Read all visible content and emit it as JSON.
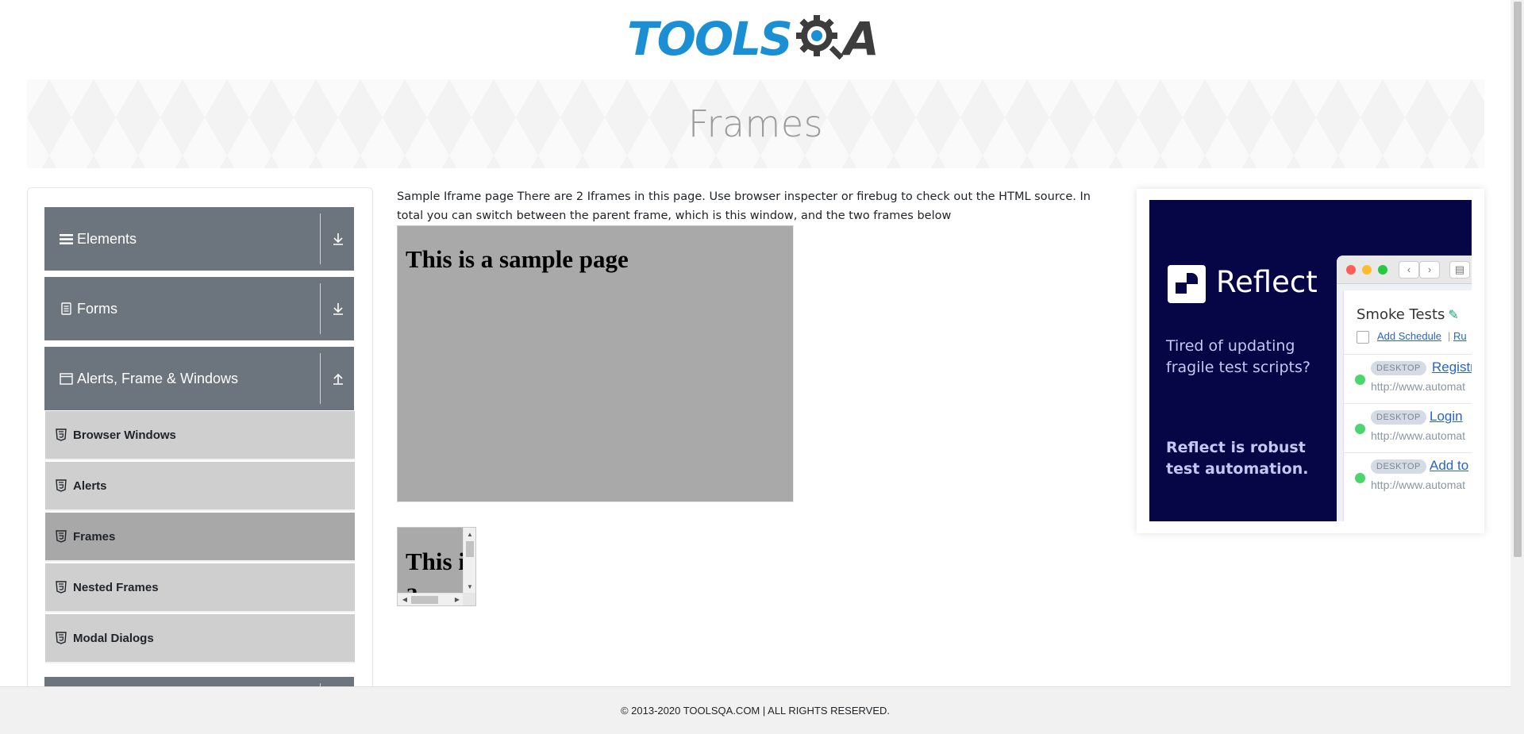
{
  "header": {
    "logo_text": "TOOLS",
    "logo_suffix": "A"
  },
  "banner": {
    "title": "Frames"
  },
  "sidebar": {
    "groups": [
      {
        "label": "Elements"
      },
      {
        "label": "Forms"
      },
      {
        "label": "Alerts, Frame & Windows"
      }
    ],
    "items": [
      {
        "label": "Browser Windows"
      },
      {
        "label": "Alerts"
      },
      {
        "label": "Frames"
      },
      {
        "label": "Nested Frames"
      },
      {
        "label": "Modal Dialogs"
      }
    ]
  },
  "main": {
    "description": "Sample Iframe page There are 2 Iframes in this page. Use browser inspecter or firebug to check out the HTML source. In total you can switch between the parent frame, which is this window, and the two frames below",
    "frame1_heading": "This is a sample page",
    "frame2_heading": "This is a"
  },
  "ad": {
    "brand": "Reflect",
    "tagline1": "Tired of updating fragile test scripts?",
    "tagline2": "Reflect is robust test automation.",
    "window": {
      "title": "Smoke Tests",
      "add_schedule": "Add Schedule",
      "run": "Ru",
      "rows": [
        {
          "chip": "DESKTOP",
          "name": "Registr",
          "url": "http://www.automat"
        },
        {
          "chip": "DESKTOP",
          "name": "Login",
          "url": "http://www.automat"
        },
        {
          "chip": "DESKTOP",
          "name": "Add to",
          "url": "http://www.automat"
        }
      ]
    }
  },
  "footer": {
    "text": "© 2013-2020 TOOLSQA.COM | ALL RIGHTS RESERVED."
  },
  "colors": {
    "logo_blue": "#1b8fd3",
    "group_bg": "#6c757d",
    "item_bg": "#cfcfcf",
    "item_active_bg": "#a8a8a8",
    "ad_bg": "#060545"
  }
}
